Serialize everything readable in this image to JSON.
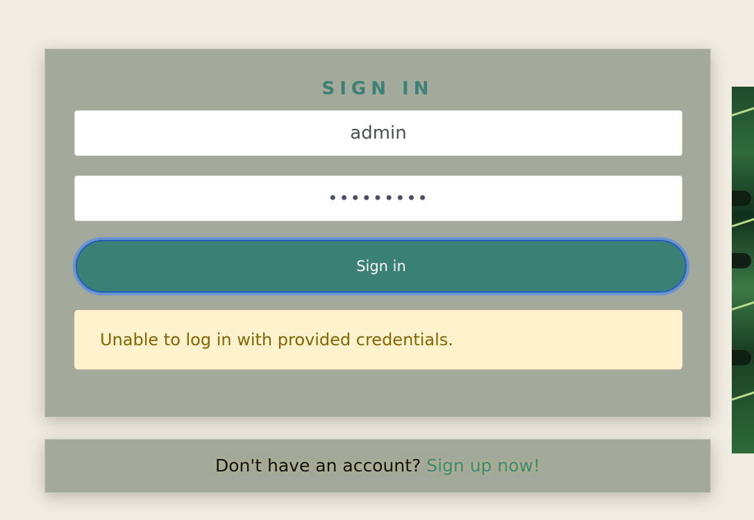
{
  "login": {
    "title": "SIGN IN",
    "username_value": "admin",
    "password_display": "•••••••••",
    "submit_label": "Sign in",
    "error_message": "Unable to log in with provided credentials."
  },
  "signup": {
    "prompt": "Don't have an account?",
    "link_label": "Sign up now!"
  },
  "colors": {
    "page_background": "#f1ece1",
    "card_background": "#a3a99b",
    "accent": "#3a8074",
    "alert_background": "#fff2cd",
    "alert_text": "#856404"
  }
}
